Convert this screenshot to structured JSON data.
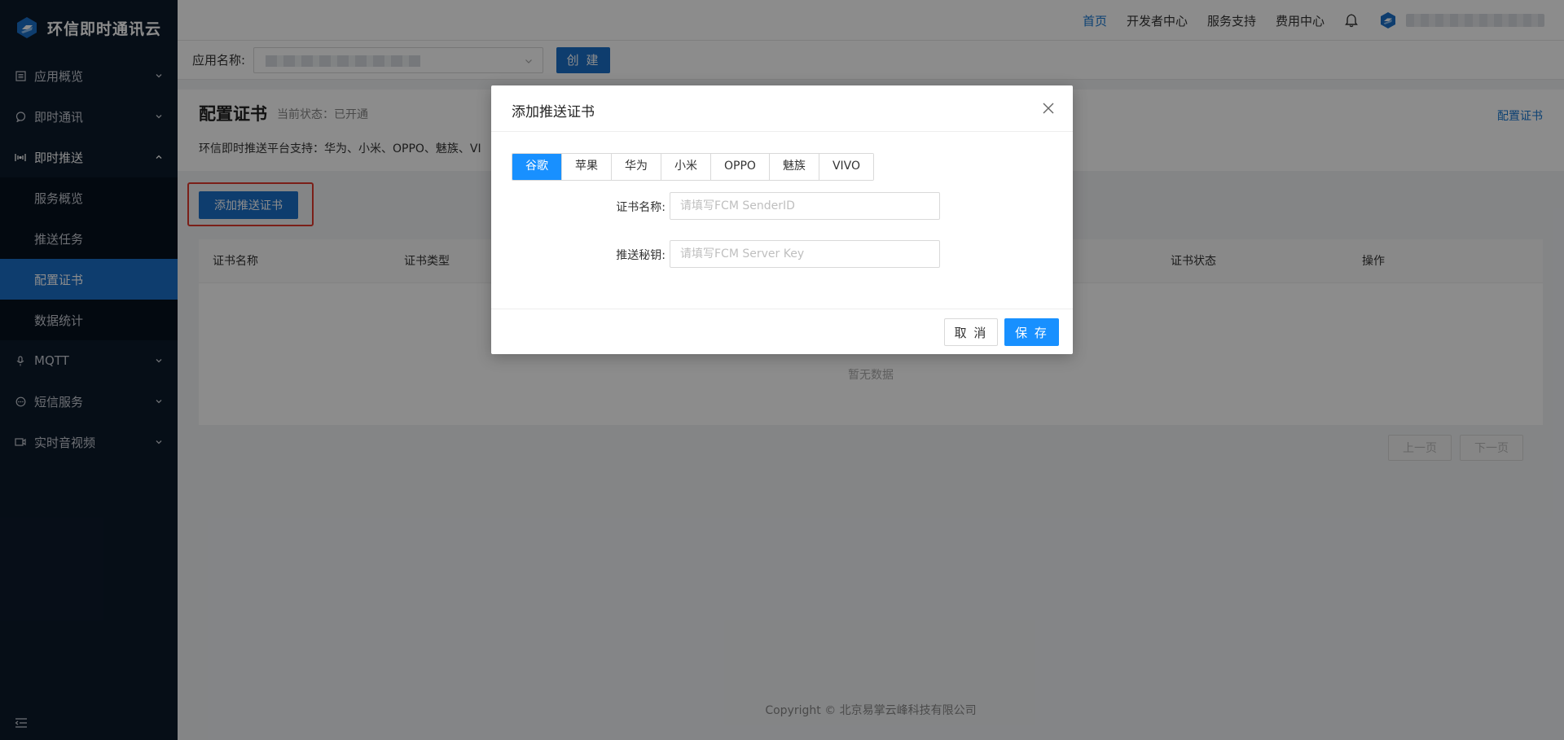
{
  "brand": {
    "name": "环信即时通讯云"
  },
  "sidebar": {
    "items": [
      {
        "label": "应用概览",
        "icon": "list-icon"
      },
      {
        "label": "即时通讯",
        "icon": "chat-icon"
      },
      {
        "label": "即时推送",
        "icon": "push-icon",
        "open": true,
        "children": [
          {
            "label": "服务概览"
          },
          {
            "label": "推送任务"
          },
          {
            "label": "配置证书",
            "active": true
          },
          {
            "label": "数据统计"
          }
        ]
      },
      {
        "label": "MQTT",
        "icon": "mic-icon"
      },
      {
        "label": "短信服务",
        "icon": "message-icon"
      },
      {
        "label": "实时音视频",
        "icon": "video-icon"
      }
    ]
  },
  "topnav": {
    "items": [
      "首页",
      "开发者中心",
      "服务支持",
      "费用中心"
    ],
    "active_index": 0
  },
  "appbar": {
    "label": "应用名称:",
    "create_label": "创 建"
  },
  "page": {
    "title": "配置证书",
    "status": "当前状态：已开通",
    "desc": "环信即时推送平台支持：华为、小米、OPPO、魅族、VI",
    "link": "配置证书",
    "add_button": "添加推送证书"
  },
  "table": {
    "columns": [
      "证书名称",
      "证书类型",
      "证书状态",
      "操作"
    ],
    "empty": "暂无数据"
  },
  "pager": {
    "prev": "上一页",
    "next": "下一页"
  },
  "footer": {
    "copyright": "Copyright © 北京易掌云峰科技有限公司"
  },
  "modal": {
    "title": "添加推送证书",
    "tabs": [
      "谷歌",
      "苹果",
      "华为",
      "小米",
      "OPPO",
      "魅族",
      "VIVO"
    ],
    "active_tab": 0,
    "fields": [
      {
        "label": "证书名称:",
        "placeholder": "请填写FCM SenderID",
        "value": ""
      },
      {
        "label": "推送秘钥:",
        "placeholder": "请填写FCM Server Key",
        "value": ""
      }
    ],
    "cancel": "取 消",
    "save": "保 存"
  },
  "colors": {
    "primary": "#1b6fc9",
    "accent": "#1890ff",
    "sidebar_bg": "#0c1a2b",
    "highlight": "#e03a2c"
  }
}
